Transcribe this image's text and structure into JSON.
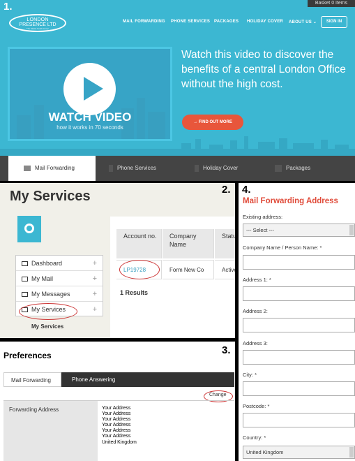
{
  "panel1": {
    "number": "1.",
    "basket": "Basket 0 Items",
    "logo": {
      "line1": "LONDON",
      "line2": "PRESENCE LTD",
      "line3": "The Martin Smith Group"
    },
    "nav": [
      "MAIL FORWARDING",
      "PHONE SERVICES",
      "PACKAGES",
      "HOLIDAY COVER",
      "ABOUT US"
    ],
    "signin": "SIGN IN",
    "video": {
      "title": "WATCH VIDEO",
      "subtitle": "how it works in 70 seconds"
    },
    "headline": "Watch this video to discover the benefits of a central London Office without the high cost.",
    "cta": "→  FIND OUT MORE",
    "tabs": [
      "Mail Forwarding",
      "Phone Services",
      "Holiday Cover",
      "Packages"
    ],
    "colors": {
      "hero": "#3cb7d2",
      "cta": "#e8563b",
      "tabbar": "#444444"
    }
  },
  "panel2": {
    "number": "2.",
    "title": "My Services",
    "sidebar": [
      "Dashboard",
      "My Mail",
      "My Messages",
      "My Services"
    ],
    "sidebar_footer": "My Services",
    "table": {
      "headers": [
        "Account no.",
        "Company Name",
        "Status"
      ],
      "rows": [
        [
          "LP19728",
          "Form New Co",
          "Active"
        ]
      ]
    },
    "results": "1 Results"
  },
  "panel3": {
    "number": "3.",
    "title": "Preferences",
    "tabs": [
      "Mail Forwarding",
      "Phone Answering"
    ],
    "change": "Change",
    "forwarding_label": "Forwarding Address",
    "address_lines": [
      "Your Address",
      "Your Address",
      "Your Address",
      "Your Address",
      "Your Address",
      "Your Address",
      "United Kingdom"
    ]
  },
  "panel4": {
    "number": "4.",
    "title": "Mail Forwarding Address",
    "existing_label": "Existing address:",
    "existing_value": "--- Select ---",
    "company_label": "Company Name / Person Name: *",
    "address1_label": "Address 1: *",
    "address2_label": "Address 2:",
    "address3_label": "Address 3:",
    "city_label": "City: *",
    "postcode_label": "Postcode: *",
    "country_label": "Country: *",
    "country_value": "United Kingdom"
  }
}
